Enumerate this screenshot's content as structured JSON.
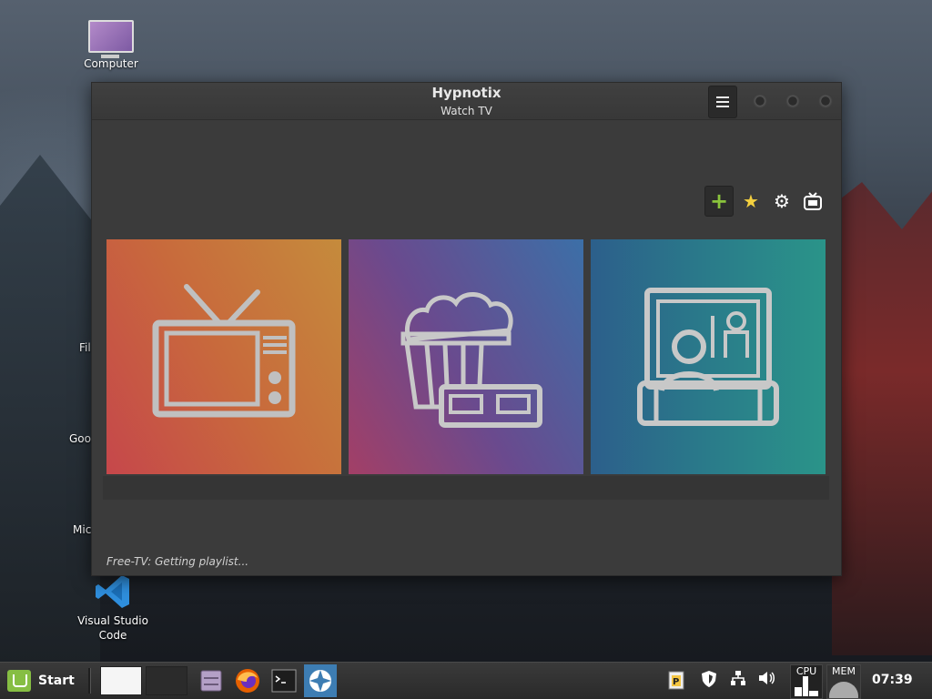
{
  "desktop": {
    "icons": [
      {
        "label": "Computer"
      },
      {
        "label": "Visual Studio\nCode"
      }
    ],
    "partial_labels": [
      "Fil",
      "Goo",
      "Mic"
    ]
  },
  "window": {
    "title": "Hypnotix",
    "subtitle": "Watch TV",
    "status": "Free-TV: Getting playlist...",
    "toolbar": {
      "add_icon": "+",
      "favorite_icon": "★",
      "settings_icon": "⚙",
      "tv_icon": "📺"
    },
    "tiles": [
      {
        "name": "tv"
      },
      {
        "name": "movies"
      },
      {
        "name": "series"
      }
    ]
  },
  "taskbar": {
    "start_label": "Start",
    "cpu_label": "CPU",
    "mem_label": "MEM",
    "clock": "07:39",
    "mint_color": "#86be43"
  }
}
